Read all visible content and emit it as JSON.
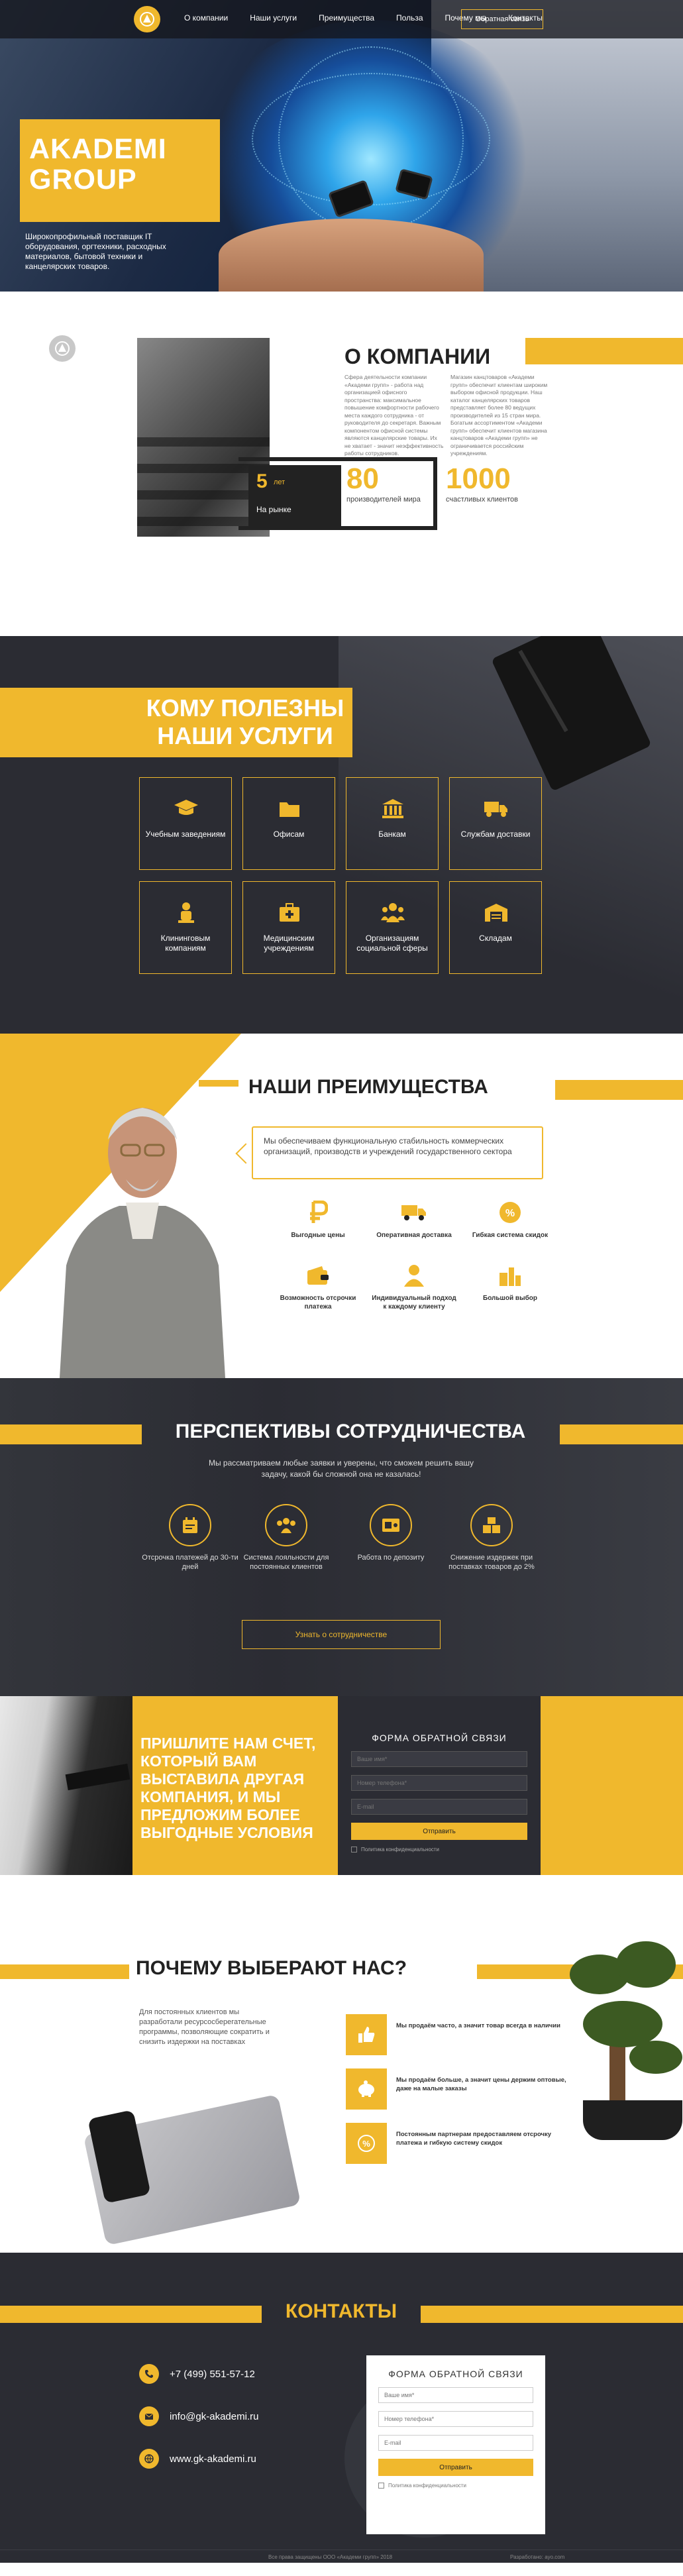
{
  "nav": {
    "items": [
      "О компании",
      "Наши услуги",
      "Преимущества",
      "Польза",
      "Почему мы",
      "Контакты"
    ],
    "button": "Обратная связь"
  },
  "hero": {
    "title_line1": "AKADEMI",
    "title_line2": "GROUP",
    "subtitle": "Широкопрофильный поставщик IT оборудования, оргтехники, расходных материалов, бытовой техники и канцелярских товаров."
  },
  "about": {
    "title": "О КОМПАНИИ",
    "col1": "Сфера деятельности компании «Академи групп» - работа над организацией офисного пространства: максимальное повышение комфортности рабочего места каждого сотрудника - от руководителя до секретаря. Важным компонентом офисной системы являются канцелярские товары. Их не хватает - значит неэффективность работы сотрудников.",
    "col2": "Магазин канцтоваров «Академи групп» обеспечит клиентам широким выбором офисной продукции. Наш каталог канцелярских товаров представляет более 80 ведущих производителей из 15 стран мира. Богатым ассортиментом «Академи групп» обеспечит клиентов магазина канцтоваров «Академи групп» не ограничивается российским учреждениям.",
    "badge_number": "5",
    "badge_suffix": "лет",
    "badge_label": "На рынке",
    "stat1_number": "80",
    "stat1_label": "производителей мира",
    "stat2_number": "1000",
    "stat2_label": "счастливых клиентов"
  },
  "services": {
    "title_line1": "КОМУ ПОЛЕЗНЫ",
    "title_line2": "НАШИ УСЛУГИ",
    "items": [
      {
        "label": "Учебным заведениям",
        "icon": "graduation-cap-icon"
      },
      {
        "label": "Офисам",
        "icon": "folder-icon"
      },
      {
        "label": "Банкам",
        "icon": "bank-icon"
      },
      {
        "label": "Службам доставки",
        "icon": "truck-icon"
      },
      {
        "label": "Клининговым компаниям",
        "icon": "cleaning-icon"
      },
      {
        "label": "Медицинским учреждениям",
        "icon": "medical-kit-icon"
      },
      {
        "label": "Организациям социальной сферы",
        "icon": "people-icon"
      },
      {
        "label": "Складам",
        "icon": "warehouse-icon"
      }
    ]
  },
  "advantages": {
    "title": "НАШИ ПРЕИМУЩЕСТВА",
    "text": "Мы обеспечиваем функциональную стабильность коммерческих организаций, производств и учреждений государственного сектора",
    "items": [
      {
        "label": "Выгодные цены",
        "icon": "ruble-icon"
      },
      {
        "label": "Оперативная доставка",
        "icon": "delivery-icon"
      },
      {
        "label": "Гибкая система скидок",
        "icon": "percent-icon"
      },
      {
        "label": "Возможность отсрочки платежа",
        "icon": "wallet-icon"
      },
      {
        "label": "Индивидуальный подход к каждому клиенту",
        "icon": "person-icon"
      },
      {
        "label": "Большой выбор",
        "icon": "products-icon"
      }
    ]
  },
  "prospects": {
    "title": "ПЕРСПЕКТИВЫ СОТРУДНИЧЕСТВА",
    "text": "Мы рассматриваем любые заявки и уверены, что сможем решить вашу задачу, какой бы сложной она не казалась!",
    "items": [
      {
        "label": "Отсрочка платежей до 30-ти дней",
        "icon": "calendar-icon"
      },
      {
        "label": "Система лояльности для постоянных клиентов",
        "icon": "loyalty-icon"
      },
      {
        "label": "Работа по депозиту",
        "icon": "deposit-icon"
      },
      {
        "label": "Снижение издержек при поставках товаров до 2%",
        "icon": "boxes-icon"
      }
    ],
    "button": "Узнать о сотрудничестве"
  },
  "invoice": {
    "title": "ПРИШЛИТЕ НАМ СЧЕТ, КОТОРЫЙ ВАМ ВЫСТАВИЛА ДРУГАЯ КОМПАНИЯ, И МЫ ПРЕДЛОЖИМ БОЛЕЕ ВЫГОДНЫЕ УСЛОВИЯ",
    "form_title": "ФОРМА ОБРАТНОЙ СВЯЗИ",
    "name_ph": "Ваше имя*",
    "phone_ph": "Номер телефона*",
    "email_ph": "E-mail",
    "button": "Отправить",
    "consent": "Политика конфиденциальности"
  },
  "why": {
    "title": "ПОЧЕМУ ВЫБЕРАЮТ НАС?",
    "text": "Для постоянных клиентов мы разработали ресурсосберегательные программы, позволяющие сократить и снизить издержки на поставках",
    "items": [
      {
        "label": "Мы продаём часто, а значит товар всегда в наличии",
        "icon": "thumbs-up-icon"
      },
      {
        "label": "Мы продаём больше, а значит цены держим оптовые, даже на малые заказы",
        "icon": "piggy-bank-icon"
      },
      {
        "label": "Постоянным партнерам предоставляем отсрочку платежа и гибкую систему скидок",
        "icon": "discount-icon"
      }
    ]
  },
  "contacts": {
    "title": "КОНТАКТЫ",
    "phone": "+7 (499) 551-57-12",
    "email": "info@gk-akademi.ru",
    "site": "www.gk-akademi.ru",
    "form_title": "ФОРМА ОБРАТНОЙ СВЯЗИ",
    "name_ph": "Ваше имя*",
    "phone_ph": "Номер телефона*",
    "email_ph": "E-mail",
    "button": "Отправить",
    "consent": "Политика конфиденциальности",
    "footer_left": "Все права защищены ООО «Академи групп» 2018",
    "footer_right": "Разработано: ayo.com"
  },
  "colors": {
    "accent": "#f0b82d",
    "dark": "#2b2c33"
  }
}
